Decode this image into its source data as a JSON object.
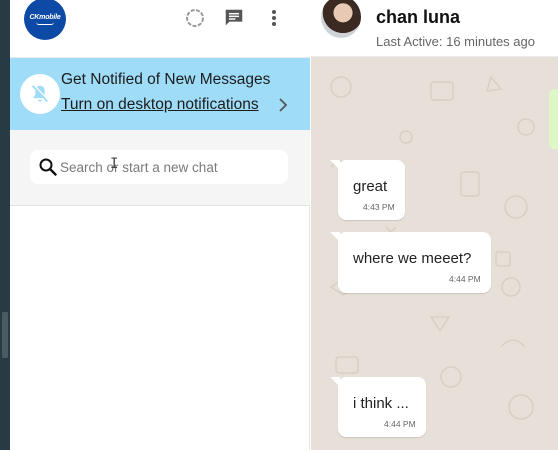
{
  "sidebar": {
    "logo_text": "CKmobile",
    "notification": {
      "title": "Get Notified of New Messages",
      "link": "Turn on desktop notifications"
    },
    "search": {
      "placeholder": "Search or start a new chat",
      "value": ""
    }
  },
  "chat": {
    "contact": {
      "name": "chan luna",
      "status": "Last Active: 16 minutes ago"
    },
    "messages": [
      {
        "text": "great",
        "time": "4:43 PM"
      },
      {
        "text": "where we meeet?",
        "time": "4:44 PM"
      },
      {
        "text": "i think ...",
        "time": "4:44 PM"
      }
    ]
  },
  "icons": {
    "status": "status-ring-icon",
    "new_chat": "message-icon",
    "menu": "kebab-menu-icon",
    "bell": "bell-off-icon",
    "chevron": "chevron-right-icon",
    "search": "search-icon"
  },
  "colors": {
    "brand": "#0d4aa6",
    "notification_bg": "#9fdcf8",
    "chat_bg": "#e7e0d8",
    "outgoing_bubble": "#dcf8c6",
    "incoming_bubble": "#ffffff"
  }
}
